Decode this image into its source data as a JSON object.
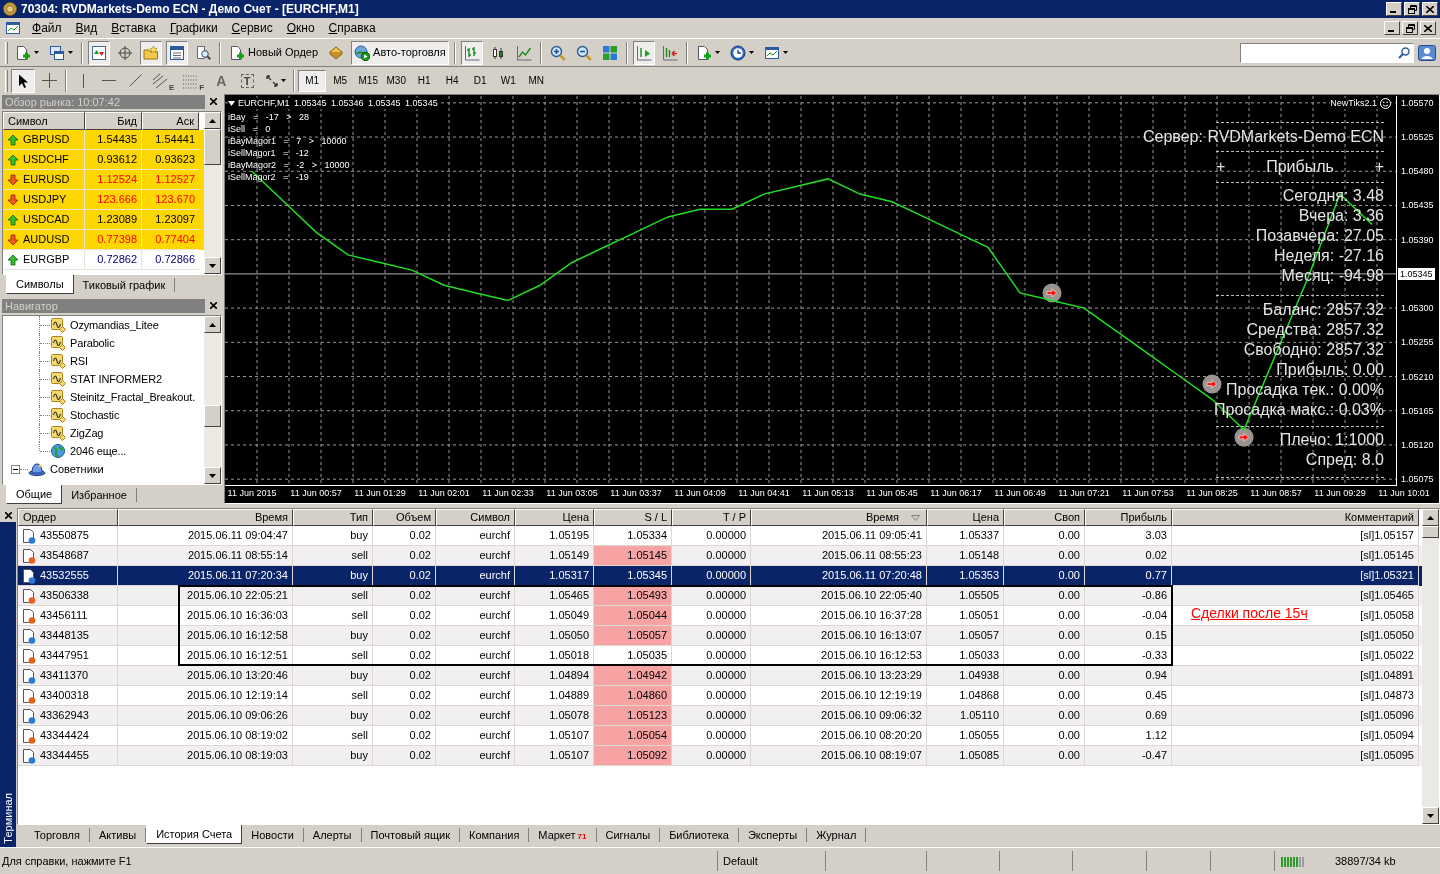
{
  "window": {
    "title": "70304: RVDMarkets-Demo ECN - Демо Счет - [EURCHF,M1]"
  },
  "menu": [
    "Файл",
    "Вид",
    "Вставка",
    "Графики",
    "Сервис",
    "Окно",
    "Справка"
  ],
  "toolbar": {
    "items": [
      {
        "pressed": false
      },
      {
        "pressed": false
      },
      {
        "pressed": true
      },
      {
        "pressed": false
      },
      {
        "pressed": true
      },
      {
        "pressed": true
      },
      {
        "pressed": false
      },
      {
        "label": "Новый Ордер",
        "pressed": false
      },
      {
        "pressed": false
      },
      {
        "label": "Авто-торговля",
        "pressed": true
      },
      {
        "pressed": true
      },
      {
        "pressed": false
      },
      {
        "pressed": false
      },
      {
        "pressed": false
      },
      {
        "pressed": false
      },
      {
        "pressed": false
      },
      {
        "pressed": true
      },
      {
        "pressed": false
      },
      {
        "pressed": false
      },
      {
        "pressed": false
      },
      {
        "pressed": false
      }
    ]
  },
  "drawing_tools": [
    {
      "pressed": true
    },
    {
      "pressed": false
    },
    {
      "pressed": false
    },
    {
      "pressed": false
    },
    {
      "pressed": false
    },
    {
      "glyph": "E",
      "pressed": false
    },
    {
      "glyph": "F",
      "pressed": false
    },
    {
      "glyph": "A",
      "pressed": false
    },
    {
      "glyph": "T",
      "pressed": false
    },
    {
      "pressed": false
    }
  ],
  "timeframes": [
    {
      "label": "M1",
      "selected": true
    },
    {
      "label": "M5",
      "selected": false
    },
    {
      "label": "M15",
      "selected": false
    },
    {
      "label": "M30",
      "selected": false
    },
    {
      "label": "H1",
      "selected": false
    },
    {
      "label": "H4",
      "selected": false
    },
    {
      "label": "D1",
      "selected": false
    },
    {
      "label": "W1",
      "selected": false
    },
    {
      "label": "MN",
      "selected": false
    }
  ],
  "market_watch": {
    "title": "Обзор рынка: 10:07:42",
    "columns": [
      "Символ",
      "Бид",
      "Аск"
    ],
    "rows": [
      {
        "symbol": "GBPUSD",
        "bid": "1.54435",
        "ask": "1.54441",
        "rising": true,
        "highlighted": true,
        "kind": "plain"
      },
      {
        "symbol": "USDCHF",
        "bid": "0.93612",
        "ask": "0.93623",
        "rising": true,
        "highlighted": true,
        "kind": "plain"
      },
      {
        "symbol": "EURUSD",
        "bid": "1.12524",
        "ask": "1.12527",
        "rising": false,
        "highlighted": true,
        "kind": "down"
      },
      {
        "symbol": "USDJPY",
        "bid": "123.666",
        "ask": "123.670",
        "rising": false,
        "highlighted": true,
        "kind": "down"
      },
      {
        "symbol": "USDCAD",
        "bid": "1.23089",
        "ask": "1.23097",
        "rising": true,
        "highlighted": true,
        "kind": "plain"
      },
      {
        "symbol": "AUDUSD",
        "bid": "0.77398",
        "ask": "0.77404",
        "rising": false,
        "highlighted": true,
        "kind": "down"
      },
      {
        "symbol": "EURGBP",
        "bid": "0.72862",
        "ask": "0.72866",
        "rising": true,
        "highlighted": false,
        "kind": "up"
      }
    ],
    "tabs": [
      {
        "label": "Символы",
        "selected": true
      },
      {
        "label": "Тиковый график",
        "selected": false
      }
    ]
  },
  "navigator": {
    "title": "Навигатор",
    "tree": [
      {
        "children": [
          {
            "label": "Ozymandias_Litee",
            "kind": "indicator"
          },
          {
            "label": "Parabolic",
            "kind": "indicator"
          },
          {
            "label": "RSI",
            "kind": "indicator"
          },
          {
            "label": "STAT INFORMER2",
            "kind": "indicator"
          },
          {
            "label": "Steinitz_Fractal_Breakout.",
            "kind": "indicator"
          },
          {
            "label": "Stochastic",
            "kind": "indicator"
          },
          {
            "label": "ZigZag",
            "kind": "indicator"
          },
          {
            "label": "2046 еще...",
            "kind": "more"
          }
        ]
      },
      {
        "label": "Советники",
        "kind": "experts",
        "expanded": true
      }
    ],
    "tabs": [
      {
        "label": "Общие",
        "selected": true
      },
      {
        "label": "Избранное",
        "selected": false
      }
    ]
  },
  "chart": {
    "header": "EURCHF,M1 1.05345 1.05346 1.05345 1.05345",
    "info_lines": [
      "iBay = -17 > 28",
      "iSell = 0",
      "iBayMagor1 = 7 > 10000",
      "iSellMagor1 = -12",
      "iBayMagor2 = -2 > 10000",
      "iSellMagor2 = -19"
    ],
    "expert": "NewTiks2.1",
    "panel": {
      "server": "Сервер: RVDMarkets-Demo ECN",
      "profit_title": "Прибыль",
      "profit_marks": [
        "+",
        "+"
      ],
      "profit_lines": [
        "Сегодня: 3.48",
        "Вчера: 3.36",
        "Позавчера: 27.05",
        "Неделя: -27.16",
        "Месяц: -94.98"
      ],
      "account_lines": [
        "Баланс: 2857.32",
        "Средства: 2857.32",
        "Свободно: 2857.32",
        "Прибыль: 0.00",
        "Просадка тек.: 0.00%",
        "Просадка макс.: 0.03%"
      ],
      "trade_lines": [
        "Плечо: 1:1000",
        "Спред: 8.0"
      ]
    },
    "chart_data": {
      "type": "line",
      "categories": [
        "11 Jun 2015",
        null,
        "11 Jun 00:57",
        null,
        "11 Jun 01:29",
        null,
        "11 Jun 02:01",
        null,
        "11 Jun 02:33",
        null,
        "11 Jun 03:05",
        null,
        "11 Jun 03:37",
        null,
        "11 Jun 04:09",
        null,
        "11 Jun 04:41",
        null,
        "11 Jun 05:13",
        null,
        "11 Jun 05:45",
        null,
        "11 Jun 06:17",
        null,
        "11 Jun 06:49",
        null,
        "11 Jun 07:21",
        null,
        "11 Jun 07:53",
        null,
        "11 Jun 08:25",
        null,
        "11 Jun 08:57",
        null,
        "11 Jun 09:29",
        null,
        "11 Jun 10:01"
      ],
      "series": [
        {
          "color": "#22dd22",
          "values": [
            1.0548,
            1.0544,
            1.054,
            1.0537,
            1.0536,
            1.0535,
            1.0533,
            1.0532,
            1.0531,
            1.0533,
            1.0536,
            1.0538,
            1.054,
            1.0542,
            1.0543,
            1.0543,
            1.0545,
            1.0546,
            1.0547,
            1.0545,
            1.0544,
            1.0542,
            1.054,
            1.0538,
            1.0532,
            1.0531,
            1.053,
            1.0527,
            1.0524,
            1.0521,
            1.0518,
            1.0514,
            1.0524,
            1.0534,
            1.0545,
            1.0541,
            null
          ]
        },
        {
          "type": "scatter",
          "color": "#9a9490",
          "values": [
            null,
            null,
            null,
            null,
            null,
            null,
            null,
            null,
            null,
            null,
            null,
            null,
            null,
            null,
            null,
            null,
            null,
            null,
            null,
            null,
            null,
            null,
            null,
            null,
            null,
            1.0532,
            null,
            null,
            null,
            null,
            1.052,
            1.0513,
            null,
            null,
            null,
            null,
            null
          ]
        }
      ],
      "ylim": [
        1.05066,
        1.05579
      ],
      "yticks": [
        {
          "value": 1.0557,
          "label": "1.05570"
        },
        {
          "value": 1.05525,
          "label": "1.05525"
        },
        {
          "value": 1.0548,
          "label": "1.05480"
        },
        {
          "value": 1.05435,
          "label": "1.05435"
        },
        {
          "value": 1.0539,
          "label": "1.05390"
        },
        {
          "value": 1.053,
          "label": "1.05300"
        },
        {
          "value": 1.05255,
          "label": "1.05255"
        },
        {
          "value": 1.0521,
          "label": "1.05210"
        },
        {
          "value": 1.05165,
          "label": "1.05165"
        },
        {
          "value": 1.0512,
          "label": "1.05120"
        },
        {
          "value": 1.05075,
          "label": "1.05075"
        }
      ],
      "grid": true,
      "ref_lines": [
        {
          "axis": "y",
          "value": 1.05345,
          "label": "1.05345",
          "color": "#b0b0b0"
        }
      ]
    }
  },
  "terminal": {
    "title": "Терминал",
    "columns": [
      {
        "label": "Ордер",
        "sorted": false
      },
      {
        "label": "Время",
        "sorted": false
      },
      {
        "label": "Тип",
        "sorted": false
      },
      {
        "label": "Объем",
        "sorted": false
      },
      {
        "label": "Символ",
        "sorted": false
      },
      {
        "label": "Цена",
        "sorted": false
      },
      {
        "label": "S / L",
        "sorted": false
      },
      {
        "label": "T / P",
        "sorted": false
      },
      {
        "label": "Время",
        "sorted": true
      },
      {
        "label": "Цена",
        "sorted": false
      },
      {
        "label": "Своп",
        "sorted": false
      },
      {
        "label": "Прибыль",
        "sorted": false
      },
      {
        "label": "Комментарий",
        "sorted": false
      }
    ],
    "rows": [
      {
        "order": "43550875",
        "open_time": "2015.06.11 09:04:47",
        "type": "buy",
        "volume": "0.02",
        "symbol": "eurchf",
        "open_price": "1.05195",
        "sl": "1.05334",
        "tp": "0.00000",
        "close_time": "2015.06.11 09:05:41",
        "close_price": "1.05337",
        "swap": "0.00",
        "profit": "3.03",
        "comment": "[sl]1.05157",
        "kind": "buy",
        "sl_hit": false,
        "selected": false,
        "boxed": false
      },
      {
        "order": "43548687",
        "open_time": "2015.06.11 08:55:14",
        "type": "sell",
        "volume": "0.02",
        "symbol": "eurchf",
        "open_price": "1.05149",
        "sl": "1.05145",
        "tp": "0.00000",
        "close_time": "2015.06.11 08:55:23",
        "close_price": "1.05148",
        "swap": "0.00",
        "profit": "0.02",
        "comment": "[sl]1.05145",
        "kind": "sell",
        "sl_hit": true,
        "selected": false,
        "boxed": false
      },
      {
        "order": "43532555",
        "open_time": "2015.06.11 07:20:34",
        "type": "buy",
        "volume": "0.02",
        "symbol": "eurchf",
        "open_price": "1.05317",
        "sl": "1.05345",
        "tp": "0.00000",
        "close_time": "2015.06.11 07:20:48",
        "close_price": "1.05353",
        "swap": "0.00",
        "profit": "0.77",
        "comment": "[sl]1.05321",
        "kind": "buy",
        "sl_hit": false,
        "selected": true,
        "boxed": false
      },
      {
        "order": "43506338",
        "open_time": "2015.06.10 22:05:21",
        "type": "sell",
        "volume": "0.02",
        "symbol": "eurchf",
        "open_price": "1.05465",
        "sl": "1.05493",
        "tp": "0.00000",
        "close_time": "2015.06.10 22:05:40",
        "close_price": "1.05505",
        "swap": "0.00",
        "profit": "-0.86",
        "comment": "[sl]1.05465",
        "kind": "sell",
        "sl_hit": true,
        "selected": false,
        "boxed": true
      },
      {
        "order": "43456111",
        "open_time": "2015.06.10 16:36:03",
        "type": "sell",
        "volume": "0.02",
        "symbol": "eurchf",
        "open_price": "1.05049",
        "sl": "1.05044",
        "tp": "0.00000",
        "close_time": "2015.06.10 16:37:28",
        "close_price": "1.05051",
        "swap": "0.00",
        "profit": "-0.04",
        "comment": "[sl]1.05058",
        "kind": "sell",
        "sl_hit": true,
        "selected": false,
        "boxed": true
      },
      {
        "order": "43448135",
        "open_time": "2015.06.10 16:12:58",
        "type": "buy",
        "volume": "0.02",
        "symbol": "eurchf",
        "open_price": "1.05050",
        "sl": "1.05057",
        "tp": "0.00000",
        "close_time": "2015.06.10 16:13:07",
        "close_price": "1.05057",
        "swap": "0.00",
        "profit": "0.15",
        "comment": "[sl]1.05050",
        "kind": "buy",
        "sl_hit": true,
        "selected": false,
        "boxed": true
      },
      {
        "order": "43447951",
        "open_time": "2015.06.10 16:12:51",
        "type": "sell",
        "volume": "0.02",
        "symbol": "eurchf",
        "open_price": "1.05018",
        "sl": "1.05035",
        "tp": "0.00000",
        "close_time": "2015.06.10 16:12:53",
        "close_price": "1.05033",
        "swap": "0.00",
        "profit": "-0.33",
        "comment": "[sl]1.05022",
        "kind": "sell",
        "sl_hit": false,
        "selected": false,
        "boxed": true
      },
      {
        "order": "43411370",
        "open_time": "2015.06.10 13:20:46",
        "type": "buy",
        "volume": "0.02",
        "symbol": "eurchf",
        "open_price": "1.04894",
        "sl": "1.04942",
        "tp": "0.00000",
        "close_time": "2015.06.10 13:23:29",
        "close_price": "1.04938",
        "swap": "0.00",
        "profit": "0.94",
        "comment": "[sl]1.04891",
        "kind": "buy",
        "sl_hit": true,
        "selected": false,
        "boxed": false
      },
      {
        "order": "43400318",
        "open_time": "2015.06.10 12:19:14",
        "type": "sell",
        "volume": "0.02",
        "symbol": "eurchf",
        "open_price": "1.04889",
        "sl": "1.04860",
        "tp": "0.00000",
        "close_time": "2015.06.10 12:19:19",
        "close_price": "1.04868",
        "swap": "0.00",
        "profit": "0.45",
        "comment": "[sl]1.04873",
        "kind": "sell",
        "sl_hit": true,
        "selected": false,
        "boxed": false
      },
      {
        "order": "43362943",
        "open_time": "2015.06.10 09:06:26",
        "type": "buy",
        "volume": "0.02",
        "symbol": "eurchf",
        "open_price": "1.05078",
        "sl": "1.05123",
        "tp": "0.00000",
        "close_time": "2015.06.10 09:06:32",
        "close_price": "1.05110",
        "swap": "0.00",
        "profit": "0.69",
        "comment": "[sl]1.05096",
        "kind": "buy",
        "sl_hit": true,
        "selected": false,
        "boxed": false
      },
      {
        "order": "43344424",
        "open_time": "2015.06.10 08:19:02",
        "type": "sell",
        "volume": "0.02",
        "symbol": "eurchf",
        "open_price": "1.05107",
        "sl": "1.05054",
        "tp": "0.00000",
        "close_time": "2015.06.10 08:20:20",
        "close_price": "1.05055",
        "swap": "0.00",
        "profit": "1.12",
        "comment": "[sl]1.05094",
        "kind": "sell",
        "sl_hit": true,
        "selected": false,
        "boxed": false
      },
      {
        "order": "43344455",
        "open_time": "2015.06.10 08:19:03",
        "type": "buy",
        "volume": "0.02",
        "symbol": "eurchf",
        "open_price": "1.05107",
        "sl": "1.05092",
        "tp": "0.00000",
        "close_time": "2015.06.10 08:19:07",
        "close_price": "1.05085",
        "swap": "0.00",
        "profit": "-0.47",
        "comment": "[sl]1.05095",
        "kind": "buy",
        "sl_hit": true,
        "selected": false,
        "boxed": false
      }
    ],
    "note": "Сделки после 15ч",
    "tabs": [
      {
        "label": "Торговля",
        "selected": false
      },
      {
        "label": "Активы",
        "selected": false
      },
      {
        "label": "История Счета",
        "selected": true
      },
      {
        "label": "Новости",
        "selected": false
      },
      {
        "label": "Алерты",
        "selected": false
      },
      {
        "label": "Почтовый ящик",
        "selected": false
      },
      {
        "label": "Компания",
        "selected": false
      },
      {
        "label": "Маркет",
        "badge": "71",
        "selected": false
      },
      {
        "label": "Сигналы",
        "selected": false
      },
      {
        "label": "Библиотека",
        "selected": false
      },
      {
        "label": "Эксперты",
        "selected": false
      },
      {
        "label": "Журнал",
        "selected": false
      }
    ]
  },
  "status_bar": {
    "help": "Для справки, нажмите F1",
    "profile": "Default",
    "traffic": "38897/34 kb"
  }
}
